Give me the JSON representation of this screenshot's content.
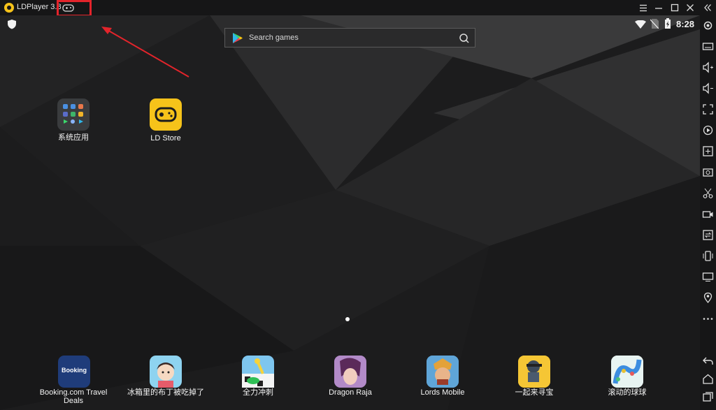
{
  "window": {
    "title": "LDPlayer 3.8",
    "controls": [
      "menu-icon",
      "minimize-icon",
      "maximize-icon",
      "close-icon",
      "collapse-sidebar-icon"
    ]
  },
  "statusbar": {
    "time": "8:28",
    "icons": [
      "shield-icon",
      "wifi-icon",
      "no-sim-icon",
      "battery-charging-icon"
    ]
  },
  "search": {
    "placeholder": "Search games"
  },
  "desktop_apps": [
    {
      "label": "系统应用",
      "icon": "system-apps-folder-icon"
    },
    {
      "label": "LD Store",
      "icon": "ld-store-icon"
    }
  ],
  "dock_apps": [
    {
      "label": "Booking.com Travel Deals",
      "icon_text": "Booking",
      "icon": "booking-icon"
    },
    {
      "label": "冰箱里的布丁被吃掉了",
      "icon": "pudding-game-icon"
    },
    {
      "label": "全力冲刺",
      "icon": "sprint-game-icon"
    },
    {
      "label": "Dragon Raja",
      "icon": "dragon-raja-icon"
    },
    {
      "label": "Lords Mobile",
      "icon": "lords-mobile-icon"
    },
    {
      "label": "一起来寻宝",
      "icon": "treasure-game-icon"
    },
    {
      "label": "滚动的球球",
      "icon": "rolling-ball-icon"
    }
  ],
  "sidebar_tools": [
    "settings-icon",
    "keyboard-icon",
    "volume-up-icon",
    "volume-down-icon",
    "fullscreen-icon",
    "record-icon",
    "add-app-icon",
    "screenshot-icon",
    "scissors-icon",
    "video-icon",
    "sync-icon",
    "shake-icon",
    "desktop-icon",
    "location-icon",
    "more-icon",
    "back-icon",
    "home-icon",
    "recent-apps-icon"
  ],
  "colors": {
    "accent": "#f6c31a",
    "annotation": "#e3242b",
    "background": "#1c1c1d"
  }
}
